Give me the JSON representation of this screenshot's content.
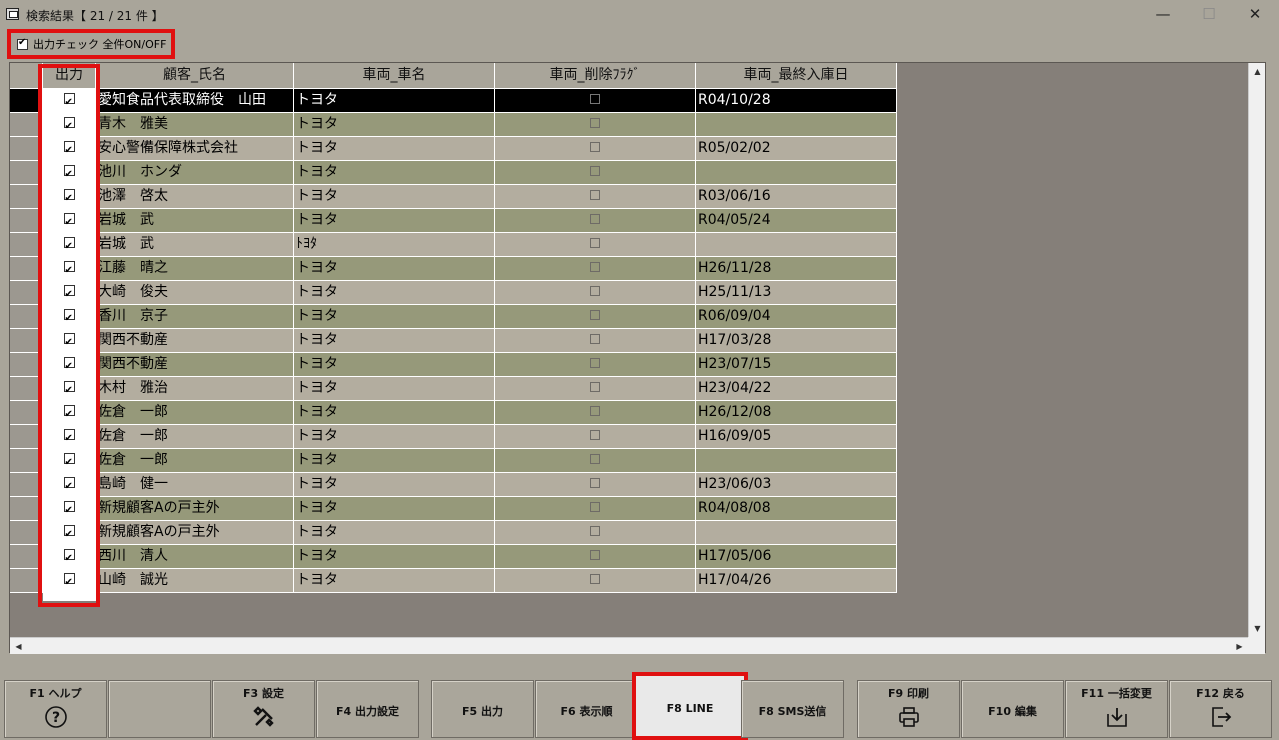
{
  "window": {
    "title": "検索結果【 21 / 21 件 】",
    "minimize": "—",
    "maximize": "☐",
    "close": "✕"
  },
  "toggle_all": {
    "label": "出力チェック 全件ON/OFF",
    "checked": true
  },
  "columns": [
    "出力",
    "顧客_氏名",
    "車両_車名",
    "車両_削除ﾌﾗｸﾞ",
    "車両_最終入庫日"
  ],
  "rows": [
    {
      "out": true,
      "name": "愛知食品代表取締役　山田",
      "car": "トヨタ",
      "deleted": false,
      "date": "R04/10/28"
    },
    {
      "out": true,
      "name": "青木　雅美",
      "car": "トヨタ",
      "deleted": false,
      "date": ""
    },
    {
      "out": true,
      "name": "安心警備保障株式会社",
      "car": "トヨタ",
      "deleted": false,
      "date": "R05/02/02"
    },
    {
      "out": true,
      "name": "池川　ホンダ",
      "car": "トヨタ",
      "deleted": false,
      "date": ""
    },
    {
      "out": true,
      "name": "池澤　啓太",
      "car": "トヨタ",
      "deleted": false,
      "date": "R03/06/16"
    },
    {
      "out": true,
      "name": "岩城　武",
      "car": "トヨタ",
      "deleted": false,
      "date": "R04/05/24"
    },
    {
      "out": true,
      "name": "岩城　武",
      "car": "ﾄﾖﾀ",
      "deleted": false,
      "date": ""
    },
    {
      "out": true,
      "name": "江藤　晴之",
      "car": "トヨタ",
      "deleted": false,
      "date": "H26/11/28"
    },
    {
      "out": true,
      "name": "大崎　俊夫",
      "car": "トヨタ",
      "deleted": false,
      "date": "H25/11/13"
    },
    {
      "out": true,
      "name": "香川　京子",
      "car": "トヨタ",
      "deleted": false,
      "date": "R06/09/04"
    },
    {
      "out": true,
      "name": "関西不動産",
      "car": "トヨタ",
      "deleted": false,
      "date": "H17/03/28"
    },
    {
      "out": true,
      "name": "関西不動産",
      "car": "トヨタ",
      "deleted": false,
      "date": "H23/07/15"
    },
    {
      "out": true,
      "name": "木村　雅治",
      "car": "トヨタ",
      "deleted": false,
      "date": "H23/04/22"
    },
    {
      "out": true,
      "name": "佐倉　一郎",
      "car": "トヨタ",
      "deleted": false,
      "date": "H26/12/08"
    },
    {
      "out": true,
      "name": "佐倉　一郎",
      "car": "トヨタ",
      "deleted": false,
      "date": "H16/09/05"
    },
    {
      "out": true,
      "name": "佐倉　一郎",
      "car": "トヨタ",
      "deleted": false,
      "date": ""
    },
    {
      "out": true,
      "name": "島崎　健一",
      "car": "トヨタ",
      "deleted": false,
      "date": "H23/06/03"
    },
    {
      "out": true,
      "name": "新規顧客Aの戸主外",
      "car": "トヨタ",
      "deleted": false,
      "date": "R04/08/08"
    },
    {
      "out": true,
      "name": "新規顧客Aの戸主外",
      "car": "トヨタ",
      "deleted": false,
      "date": ""
    },
    {
      "out": true,
      "name": "西川　清人",
      "car": "トヨタ",
      "deleted": false,
      "date": "H17/05/06"
    },
    {
      "out": true,
      "name": "山崎　誠光",
      "car": "トヨタ",
      "deleted": false,
      "date": "H17/04/26"
    }
  ],
  "function_keys": [
    {
      "id": "f1",
      "label": "F1 ヘルプ",
      "icon": "help-icon"
    },
    {
      "id": "f2",
      "label": "",
      "icon": ""
    },
    {
      "id": "f3",
      "label": "F3 設定",
      "icon": "tools-icon"
    },
    {
      "id": "f4",
      "label": "F4 出力設定",
      "icon": ""
    },
    {
      "id": "f5",
      "label": "F5 出力",
      "icon": ""
    },
    {
      "id": "f6",
      "label": "F6 表示順",
      "icon": ""
    },
    {
      "id": "f8",
      "label": "F8 LINE",
      "icon": "",
      "highlighted": true
    },
    {
      "id": "f8sms",
      "label": "F8 SMS送信",
      "icon": ""
    },
    {
      "id": "f9",
      "label": "F9 印刷",
      "icon": "printer-icon"
    },
    {
      "id": "f10",
      "label": "F10 編集",
      "icon": ""
    },
    {
      "id": "f11",
      "label": "F11 一括変更",
      "icon": "import-icon"
    },
    {
      "id": "f12",
      "label": "F12 戻る",
      "icon": "exit-icon"
    }
  ]
}
